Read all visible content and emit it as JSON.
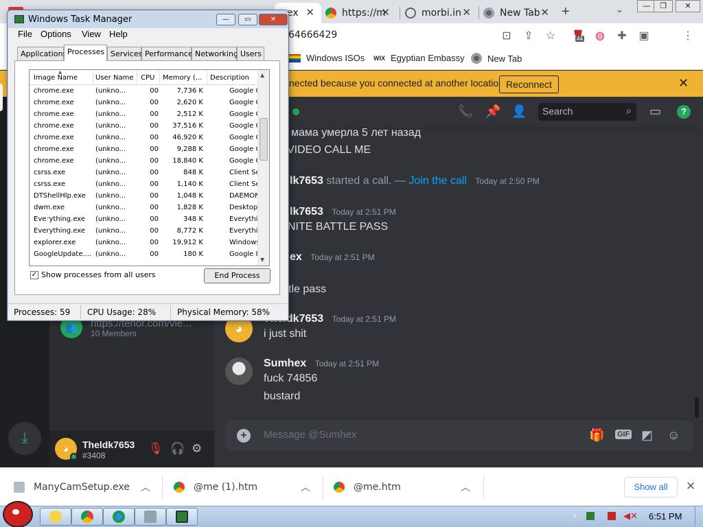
{
  "chrome": {
    "tabs": [
      {
        "title": "ex",
        "active": true
      },
      {
        "title": "https://m"
      },
      {
        "title": "morbi.in"
      },
      {
        "title": "New Tab"
      }
    ],
    "new_tab": "+",
    "omnibox": "64666429",
    "extension_badge": "44",
    "bookmarks": [
      "Windows ISOs",
      "Egyptian Embassy",
      "New Tab"
    ],
    "bookmark_prefix": "WIX"
  },
  "discord": {
    "notice": {
      "text": "nected because you connected at another location.",
      "button": "Reconnect"
    },
    "header": {
      "search_placeholder": "Search",
      "help": "?"
    },
    "messages": {
      "m1": "мама умерла 5 лет назад",
      "m2": "VIDEO CALL ME",
      "call_author": "lk7653",
      "call_text": "started a call. —",
      "call_link": "Join the call",
      "call_ts": "Today at 2:50 PM",
      "a2": "lk7653",
      "a2_ts": "Today at 2:51 PM",
      "m3": "NITE BATTLE PASS",
      "a3": "ex",
      "a3_ts": "Today at 2:51 PM",
      "m4": "tle pass",
      "a4": "Theldk7653",
      "a4_ts": "Today at 2:51 PM",
      "m5": "i just shit",
      "a5": "Sumhex",
      "a5_ts": "Today at 2:51 PM",
      "m6": "fuck 74856",
      "m7": "bustard"
    },
    "composer_placeholder": "Message @Sumhex",
    "gif_label": "GIF",
    "dm_group": {
      "name": "https://tenor.com/vie...",
      "members": "10 Members"
    },
    "user": {
      "name": "Theldk7653",
      "tag": "#3408"
    }
  },
  "taskmgr": {
    "title": "Windows Task Manager",
    "menu": [
      "File",
      "Options",
      "View",
      "Help"
    ],
    "tabs": [
      "Applications",
      "Processes",
      "Services",
      "Performance",
      "Networking",
      "Users"
    ],
    "active_tab": "Processes",
    "columns": [
      "Image Name",
      "User Name",
      "CPU",
      "Memory (...",
      "Description"
    ],
    "rows": [
      [
        "chrome.exe",
        "(unkno...",
        "00",
        "7,736 K",
        "Google C..."
      ],
      [
        "chrome.exe",
        "(unkno...",
        "00",
        "2,620 K",
        "Google C..."
      ],
      [
        "chrome.exe",
        "(unkno...",
        "00",
        "2,512 K",
        "Google C..."
      ],
      [
        "chrome.exe",
        "(unkno...",
        "00",
        "37,516 K",
        "Google C..."
      ],
      [
        "chrome.exe",
        "(unkno...",
        "00",
        "46,920 K",
        "Google C..."
      ],
      [
        "chrome.exe",
        "(unkno...",
        "00",
        "9,288 K",
        "Google C..."
      ],
      [
        "chrome.exe",
        "(unkno...",
        "00",
        "18,840 K",
        "Google C..."
      ],
      [
        "csrss.exe",
        "(unkno...",
        "00",
        "848 K",
        "Client Ser..."
      ],
      [
        "csrss.exe",
        "(unkno...",
        "00",
        "1,140 K",
        "Client Ser..."
      ],
      [
        "DTShellHlp.exe",
        "(unkno...",
        "00",
        "1,048 K",
        "DAEMON ..."
      ],
      [
        "dwm.exe",
        "(unkno...",
        "00",
        "1,828 K",
        "Desktop ..."
      ],
      [
        "Everything.exe",
        "(unkno...",
        "00",
        "348 K",
        "Everything"
      ],
      [
        "Everything.exe",
        "(unkno...",
        "00",
        "8,772 K",
        "Everything"
      ],
      [
        "explorer.exe",
        "(unkno...",
        "00",
        "19,912 K",
        "Windows ..."
      ],
      [
        "GoogleUpdate....",
        "(unkno...",
        "00",
        "180 K",
        "Google In..."
      ]
    ],
    "show_all_label": "Show processes from all users",
    "show_all_checked": true,
    "end_process": "End Process",
    "status": {
      "processes": "Processes: 59",
      "cpu": "CPU Usage: 28%",
      "memory": "Physical Memory: 58%"
    }
  },
  "downloads": {
    "items": [
      "ManyCamSetup.exe",
      "@me (1).htm",
      "@me.htm"
    ],
    "show_all": "Show all"
  },
  "taskbar": {
    "clock": "6:51 PM"
  }
}
